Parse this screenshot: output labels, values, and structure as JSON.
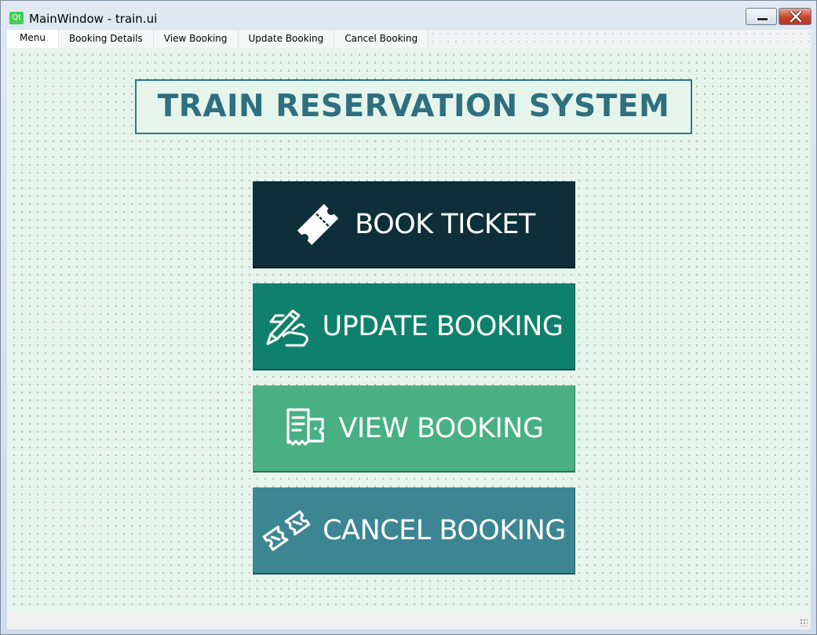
{
  "window": {
    "app_icon_text": "Qt",
    "title": "MainWindow - train.ui"
  },
  "menu": {
    "items": [
      {
        "label": "Menu"
      },
      {
        "label": "Booking Details"
      },
      {
        "label": "View Booking"
      },
      {
        "label": "Update Booking"
      },
      {
        "label": "Cancel Booking"
      }
    ]
  },
  "main": {
    "heading": "TRAIN RESERVATION SYSTEM",
    "buttons": [
      {
        "label": "BOOK TICKET",
        "icon": "ticket-icon",
        "color": "#0e2e3a"
      },
      {
        "label": "UPDATE BOOKING",
        "icon": "hand-writing-icon",
        "color": "#0f806e"
      },
      {
        "label": "VIEW BOOKING",
        "icon": "receipt-icon",
        "color": "#48b082"
      },
      {
        "label": "CANCEL BOOKING",
        "icon": "torn-ticket-icon",
        "color": "#3c8694"
      }
    ]
  }
}
